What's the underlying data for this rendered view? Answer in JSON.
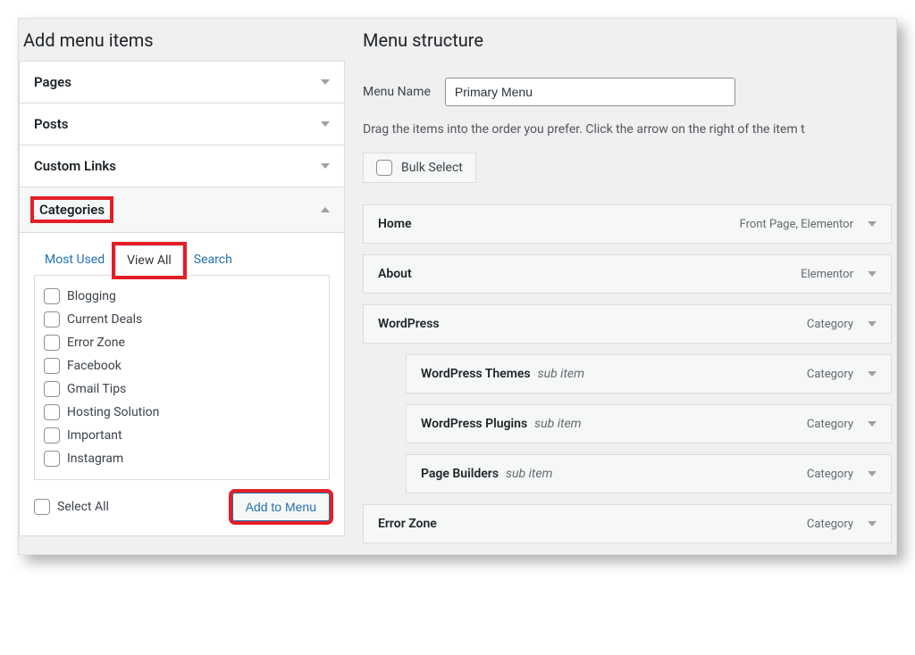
{
  "leftPanel": {
    "title": "Add menu items",
    "accordions": {
      "pages": "Pages",
      "posts": "Posts",
      "customLinks": "Custom Links",
      "categories": "Categories"
    },
    "tabs": {
      "mostUsed": "Most Used",
      "viewAll": "View All",
      "search": "Search"
    },
    "categoryItems": [
      "Blogging",
      "Current Deals",
      "Error Zone",
      "Facebook",
      "Gmail Tips",
      "Hosting Solution",
      "Important",
      "Instagram"
    ],
    "selectAll": "Select All",
    "addToMenu": "Add to Menu"
  },
  "rightPanel": {
    "title": "Menu structure",
    "menuNameLabel": "Menu Name",
    "menuNameValue": "Primary Menu",
    "instruction": "Drag the items into the order you prefer. Click the arrow on the right of the item t",
    "bulkSelect": "Bulk Select",
    "menuItems": [
      {
        "title": "Home",
        "type": "Front Page, Elementor",
        "indent": false,
        "sub": false
      },
      {
        "title": "About",
        "type": "Elementor",
        "indent": false,
        "sub": false
      },
      {
        "title": "WordPress",
        "type": "Category",
        "indent": false,
        "sub": false
      },
      {
        "title": "WordPress Themes",
        "type": "Category",
        "indent": true,
        "sub": true
      },
      {
        "title": "WordPress Plugins",
        "type": "Category",
        "indent": true,
        "sub": true
      },
      {
        "title": "Page Builders",
        "type": "Category",
        "indent": true,
        "sub": true
      },
      {
        "title": "Error Zone",
        "type": "Category",
        "indent": false,
        "sub": false
      }
    ],
    "subItemLabel": "sub item"
  }
}
